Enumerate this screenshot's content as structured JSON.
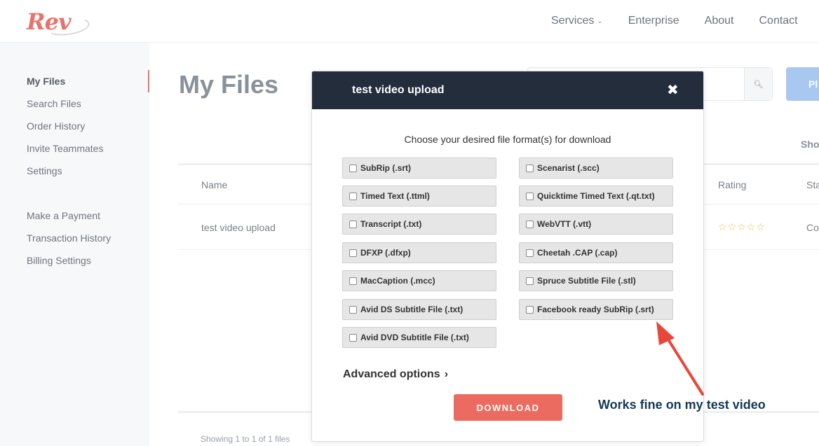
{
  "header": {
    "logo_text": "Rev",
    "nav": [
      {
        "label": "Services",
        "has_dropdown": true
      },
      {
        "label": "Enterprise",
        "has_dropdown": false
      },
      {
        "label": "About",
        "has_dropdown": false
      },
      {
        "label": "Contact",
        "has_dropdown": false
      }
    ]
  },
  "sidebar": {
    "items": [
      {
        "label": "My Files",
        "active": true
      },
      {
        "label": "Search Files"
      },
      {
        "label": "Order History"
      },
      {
        "label": "Invite Teammates"
      },
      {
        "label": "Settings"
      },
      {
        "label": "Make a Payment"
      },
      {
        "label": "Transaction History"
      },
      {
        "label": "Billing Settings"
      }
    ]
  },
  "main": {
    "page_title": "My Files",
    "place_button_label": "Pl",
    "show_label": "Sho",
    "table": {
      "headers": [
        "Name",
        "Rating",
        "Sta"
      ],
      "rows": [
        {
          "name": "test video upload",
          "rating_stars": "☆☆☆☆☆",
          "rating_value": 0,
          "rating_max": 5,
          "status": "Co"
        }
      ]
    },
    "showing_text": "Showing 1 to 1 of 1 files"
  },
  "modal": {
    "title": "test video upload",
    "close_glyph": "✖",
    "subtitle": "Choose your desired file format(s) for download",
    "formats_left": [
      "SubRip (.srt)",
      "Timed Text (.ttml)",
      "Transcript (.txt)",
      "DFXP (.dfxp)",
      "MacCaption (.mcc)",
      "Avid DS Subtitle File (.txt)",
      "Avid DVD Subtitle File (.txt)"
    ],
    "formats_right": [
      "Scenarist (.scc)",
      "Quicktime Timed Text (.qt.txt)",
      "WebVTT (.vtt)",
      "Cheetah .CAP (.cap)",
      "Spruce Subtitle File (.stl)",
      "Facebook ready SubRip (.srt)"
    ],
    "advanced_label": "Advanced options",
    "download_label": "DOWNLOAD"
  },
  "annotation": {
    "text": "Works fine on my test video",
    "color": "#163a54",
    "arrow_color": "#e8473a"
  },
  "colors": {
    "brand": "#e8736c",
    "modal_header": "#232d3c",
    "download_button": "#ec6b60"
  }
}
